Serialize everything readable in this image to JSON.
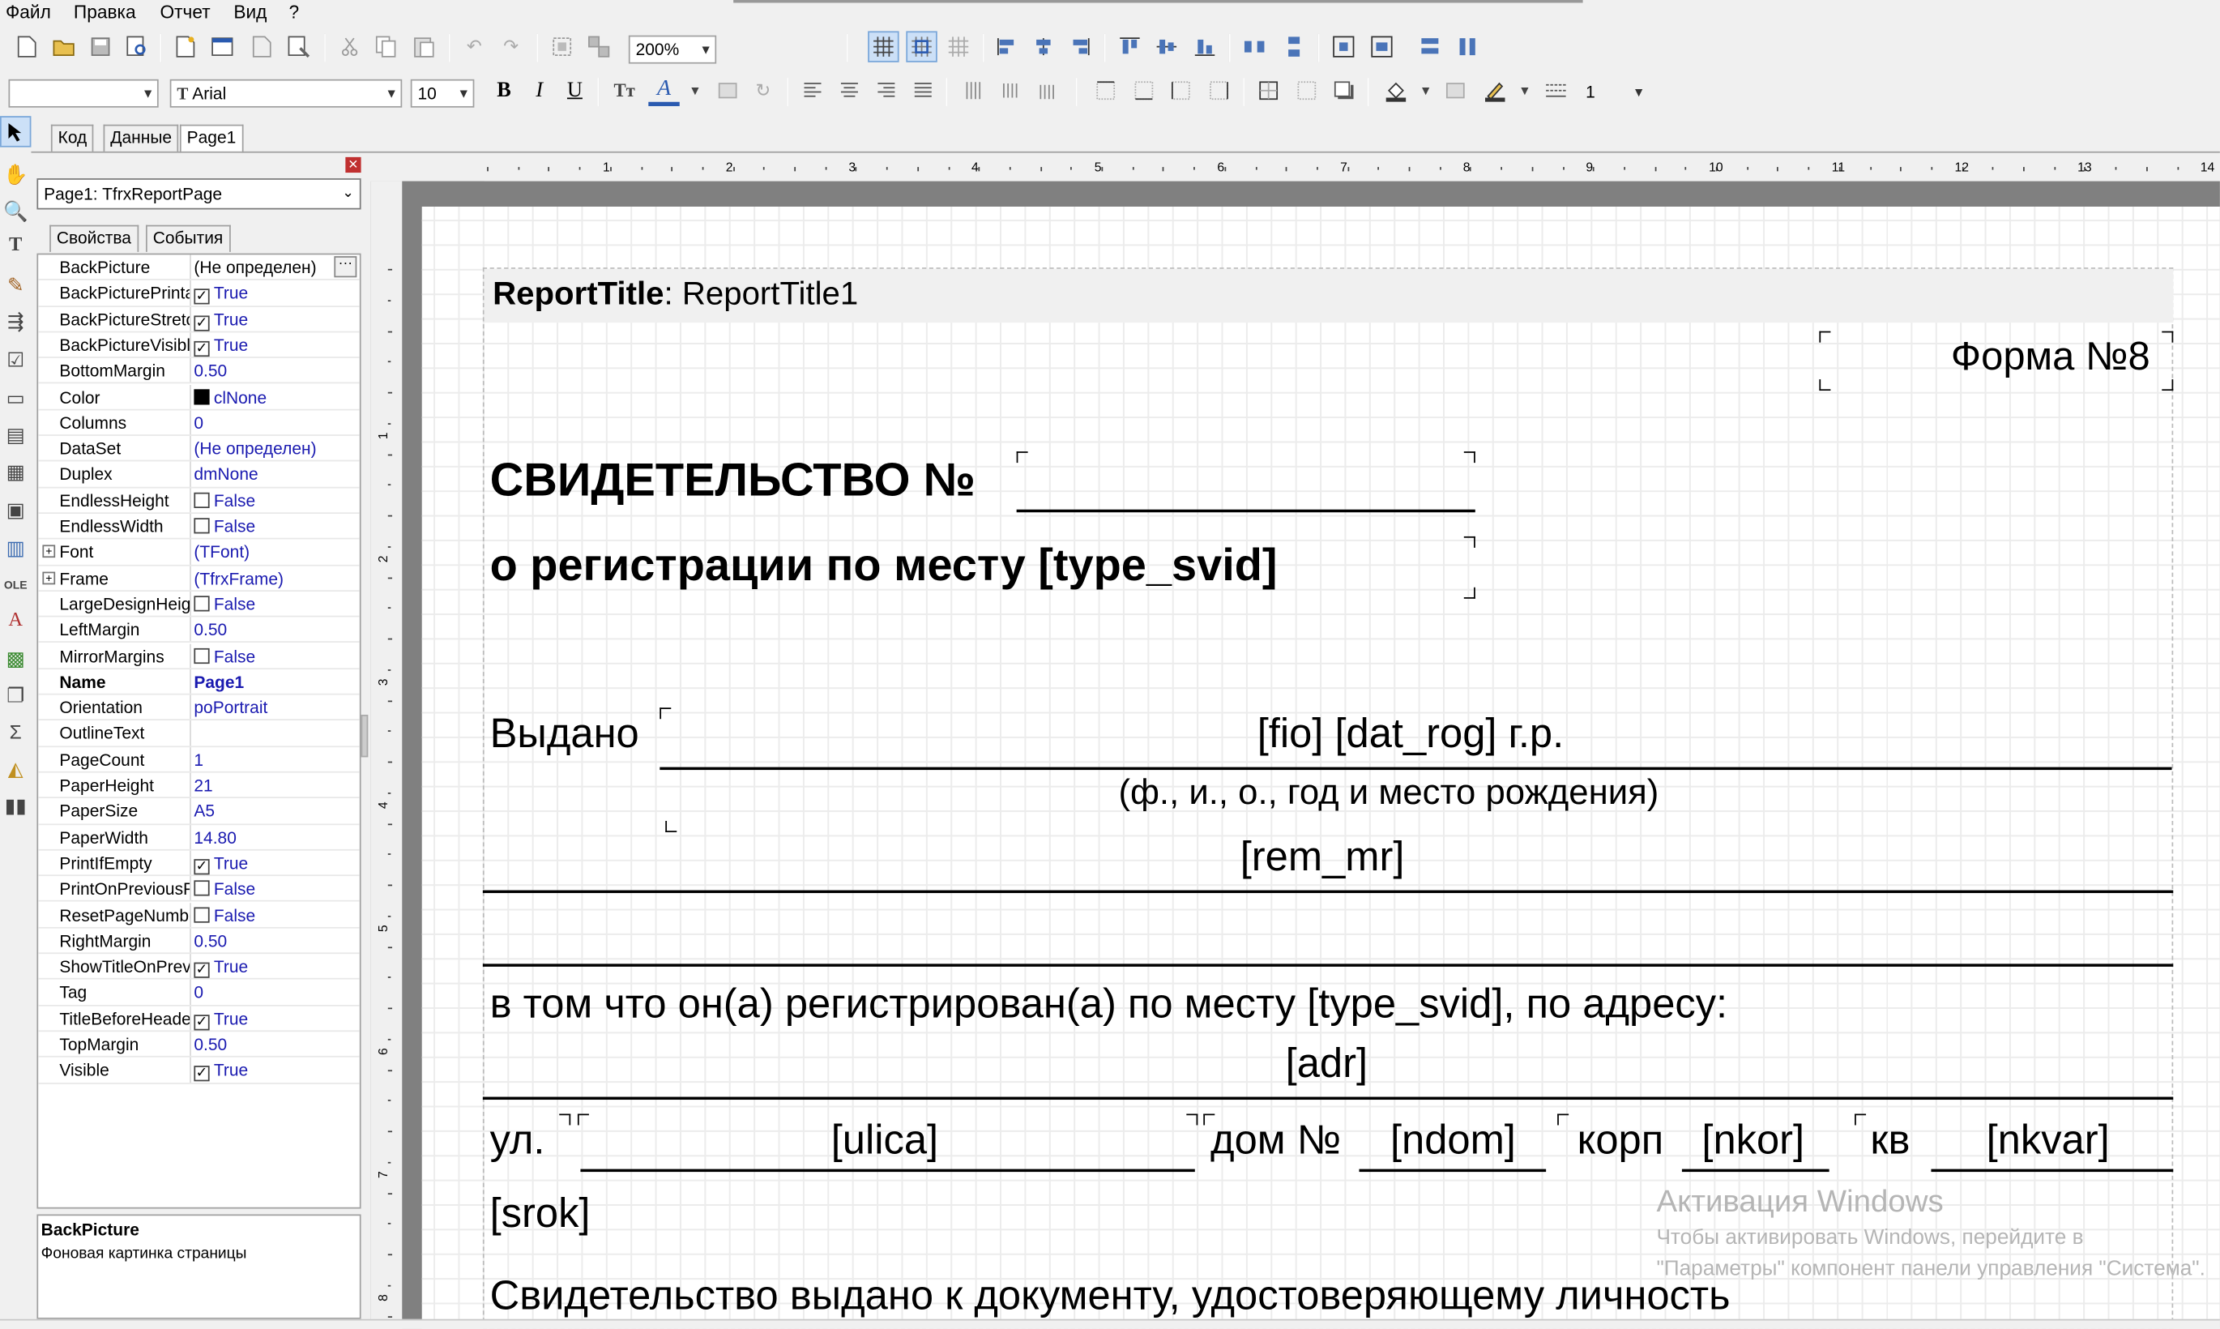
{
  "menu": [
    "Файл",
    "Правка",
    "Отчет",
    "Вид",
    "?"
  ],
  "toolbar": {
    "zoom": "200%",
    "font_name": "Arial",
    "font_size": "10",
    "style_combo": "",
    "line_width": "1",
    "bold": "B",
    "italic": "I",
    "underline": "U"
  },
  "tabs": [
    "Код",
    "Данные",
    "Page1"
  ],
  "object_selector": "Page1: TfrxReportPage",
  "inspector_tabs": [
    "Свойства",
    "События"
  ],
  "properties": [
    {
      "name": "BackPicture",
      "value": "(Не определен)",
      "kind": "text",
      "vcolor": "#000000",
      "ellipsis": true
    },
    {
      "name": "BackPicturePrintable",
      "value": "True",
      "kind": "check",
      "checked": true
    },
    {
      "name": "BackPictureStretched",
      "value": "True",
      "kind": "check",
      "checked": true
    },
    {
      "name": "BackPictureVisible",
      "value": "True",
      "kind": "check",
      "checked": true
    },
    {
      "name": "BottomMargin",
      "value": "0.50",
      "kind": "text"
    },
    {
      "name": "Color",
      "value": "clNone",
      "kind": "color"
    },
    {
      "name": "Columns",
      "value": "0",
      "kind": "text"
    },
    {
      "name": "DataSet",
      "value": "(Не определен)",
      "kind": "text"
    },
    {
      "name": "Duplex",
      "value": "dmNone",
      "kind": "text"
    },
    {
      "name": "EndlessHeight",
      "value": "False",
      "kind": "check",
      "checked": false
    },
    {
      "name": "EndlessWidth",
      "value": "False",
      "kind": "check",
      "checked": false
    },
    {
      "name": "Font",
      "value": "(TFont)",
      "kind": "text",
      "expand": true
    },
    {
      "name": "Frame",
      "value": "(TfrxFrame)",
      "kind": "text",
      "expand": true
    },
    {
      "name": "LargeDesignHeight",
      "value": "False",
      "kind": "check",
      "checked": false
    },
    {
      "name": "LeftMargin",
      "value": "0.50",
      "kind": "text"
    },
    {
      "name": "MirrorMargins",
      "value": "False",
      "kind": "check",
      "checked": false
    },
    {
      "name": "Name",
      "value": "Page1",
      "kind": "text",
      "bold": true
    },
    {
      "name": "Orientation",
      "value": "poPortrait",
      "kind": "text"
    },
    {
      "name": "OutlineText",
      "value": "",
      "kind": "text"
    },
    {
      "name": "PageCount",
      "value": "1",
      "kind": "text"
    },
    {
      "name": "PaperHeight",
      "value": "21",
      "kind": "text"
    },
    {
      "name": "PaperSize",
      "value": "A5",
      "kind": "text"
    },
    {
      "name": "PaperWidth",
      "value": "14.80",
      "kind": "text"
    },
    {
      "name": "PrintIfEmpty",
      "value": "True",
      "kind": "check",
      "checked": true
    },
    {
      "name": "PrintOnPreviousPage",
      "value": "False",
      "kind": "check",
      "checked": false
    },
    {
      "name": "ResetPageNumbers",
      "value": "False",
      "kind": "check",
      "checked": false
    },
    {
      "name": "RightMargin",
      "value": "0.50",
      "kind": "text"
    },
    {
      "name": "ShowTitleOnPreviousPage",
      "value": "True",
      "kind": "check",
      "checked": true
    },
    {
      "name": "Tag",
      "value": "0",
      "kind": "text"
    },
    {
      "name": "TitleBeforeHeader",
      "value": "True",
      "kind": "check",
      "checked": true
    },
    {
      "name": "TopMargin",
      "value": "0.50",
      "kind": "text"
    },
    {
      "name": "Visible",
      "value": "True",
      "kind": "check",
      "checked": true
    }
  ],
  "help": {
    "title": "BackPicture",
    "text": "Фоновая картинка страницы"
  },
  "ruler_top": [
    "1",
    "2",
    "3",
    "4",
    "5",
    "6",
    "7",
    "8",
    "9",
    "10",
    "11",
    "12",
    "13",
    "14"
  ],
  "ruler_left": [
    "1",
    "2",
    "3",
    "4",
    "5",
    "6",
    "7",
    "8"
  ],
  "report": {
    "band_label": "ReportTitle",
    "band_name": ": ReportTitle1",
    "form_no": "Форма №8",
    "cert_title": "СВИДЕТЕЛЬСТВО №",
    "cert_subtitle": "о регистрации по месту [type_svid]",
    "issued": "Выдано",
    "fio": "[fio] [dat_rog] г.р.",
    "fio_hint": "(ф., и., о., год и место рождения)",
    "rem_mr": "[rem_mr]",
    "registered": "в том что он(а) регистрирован(а) по месту [type_svid], по адресу:",
    "adr": "[adr]",
    "street_label": "ул.",
    "street": "[ulica]",
    "house_label": "дом №",
    "house": "[ndom]",
    "korp_label": "корп",
    "korp": "[nkor]",
    "kv_label": "кв",
    "kv": "[nkvar]",
    "srok": "[srok]",
    "doc_line": "Свидетельство выдано к документу, удостоверяющему личность"
  },
  "watermark": {
    "line1": "Активация Windows",
    "line2": "Чтобы активировать Windows, перейдите в",
    "line3": "\"Параметры\" компонент панели управления \"Система\"."
  }
}
